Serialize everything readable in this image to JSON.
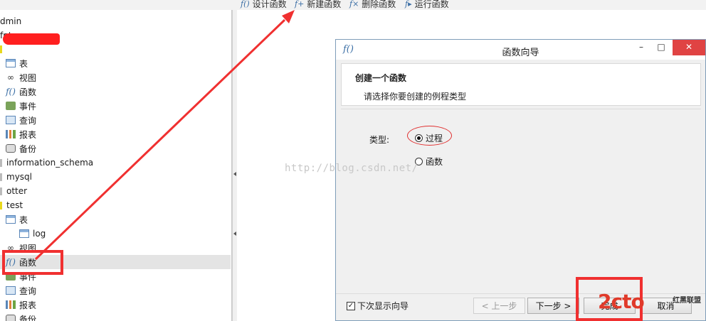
{
  "toolbar": {
    "items": [
      {
        "label": "设计函数"
      },
      {
        "label": "新建函数"
      },
      {
        "label": "删除函数"
      },
      {
        "label": "运行函数"
      }
    ]
  },
  "tree": {
    "admin": "dmin",
    "fpt": "fpt",
    "fpt_children": [
      "表",
      "视图",
      "函数",
      "事件",
      "查询",
      "报表",
      "备份"
    ],
    "dbs": [
      "information_schema",
      "mysql",
      "otter",
      "test"
    ],
    "test_table": "表",
    "test_log": "log",
    "test_children": [
      "视图",
      "函数",
      "事件",
      "查询",
      "报表",
      "备份"
    ]
  },
  "dialog": {
    "title": "函数向导",
    "heading": "创建一个函数",
    "subheading": "请选择你要创建的例程类型",
    "type_label": "类型:",
    "option_procedure": "过程",
    "option_function": "函数",
    "selected": "过程",
    "checkbox_label": "下次显示向导",
    "checkbox_checked": true,
    "btn_prev": "< 上一步",
    "btn_next": "下一步 >",
    "btn_finish": "完成",
    "btn_cancel": "取消",
    "min_glyph": "–",
    "max_glyph": "□",
    "close_glyph": "✕"
  },
  "watermark": "http://blog.csdn.net/",
  "logo": {
    "text": "2cto",
    "sub": "红黑联盟"
  },
  "colors": {
    "annotation_red": "#f03030",
    "accent_blue": "#3a6ea5"
  }
}
